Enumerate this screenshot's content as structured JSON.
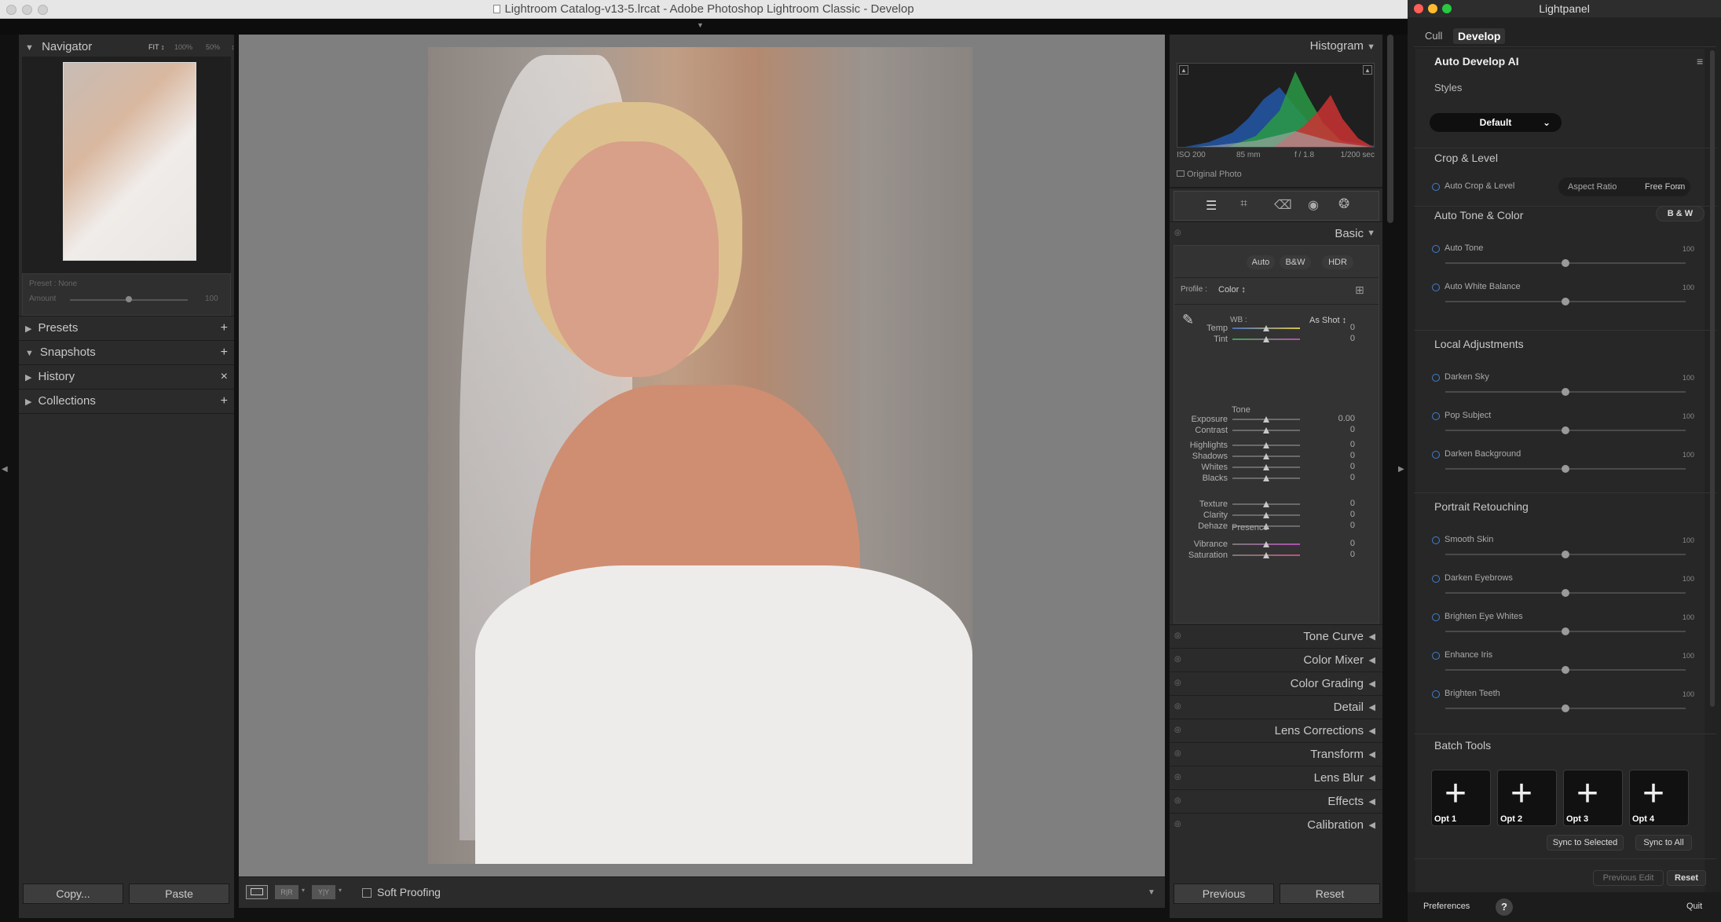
{
  "window": {
    "title": "Lightroom Catalog-v13-5.lrcat - Adobe Photoshop Lightroom Classic - Develop"
  },
  "navigator": {
    "title": "Navigator",
    "zoom_options": [
      "FIT",
      "100%",
      "50%"
    ],
    "fit_label": "FIT ↕"
  },
  "preset_box": {
    "preset_label": "Preset : None",
    "amount_label": "Amount",
    "amount_value": "100"
  },
  "left_panels": [
    {
      "label": "Presets",
      "action": "+"
    },
    {
      "label": "Snapshots",
      "action": "+"
    },
    {
      "label": "History",
      "action": "×"
    },
    {
      "label": "Collections",
      "action": "+"
    }
  ],
  "left_buttons": {
    "copy": "Copy...",
    "paste": "Paste"
  },
  "toolbar": {
    "soft_proofing": "Soft Proofing"
  },
  "histogram": {
    "title": "Histogram",
    "exif": {
      "iso": "ISO 200",
      "focal": "85 mm",
      "aperture": "f / 1.8",
      "shutter": "1/200 sec"
    },
    "original_photo": "Original Photo"
  },
  "basic": {
    "title": "Basic",
    "buttons": [
      "Auto",
      "B&W",
      "HDR"
    ],
    "profile_label": "Profile :",
    "profile_value": "Color",
    "wb_label": "WB :",
    "wb_value": "As Shot",
    "tone_label": "Tone",
    "presence_label": "Presence",
    "wb_sliders": [
      {
        "label": "Temp",
        "value": "0"
      },
      {
        "label": "Tint",
        "value": "0"
      }
    ],
    "tone_sliders": [
      {
        "label": "Exposure",
        "value": "0.00"
      },
      {
        "label": "Contrast",
        "value": "0"
      },
      {
        "label": "Highlights",
        "value": "0"
      },
      {
        "label": "Shadows",
        "value": "0"
      },
      {
        "label": "Whites",
        "value": "0"
      },
      {
        "label": "Blacks",
        "value": "0"
      }
    ],
    "presence_sliders": [
      {
        "label": "Texture",
        "value": "0"
      },
      {
        "label": "Clarity",
        "value": "0"
      },
      {
        "label": "Dehaze",
        "value": "0"
      },
      {
        "label": "Vibrance",
        "value": "0"
      },
      {
        "label": "Saturation",
        "value": "0"
      }
    ]
  },
  "right_panels": [
    "Tone Curve",
    "Color Mixer",
    "Color Grading",
    "Detail",
    "Lens Corrections",
    "Transform",
    "Lens Blur",
    "Effects",
    "Calibration"
  ],
  "right_buttons": {
    "previous": "Previous",
    "reset": "Reset"
  },
  "lightpanel": {
    "title": "Lightpanel",
    "tabs": [
      "Cull",
      "Develop"
    ],
    "heading": "Auto Develop AI",
    "styles_label": "Styles",
    "style_value": "Default",
    "crop_section": "Crop & Level",
    "auto_crop": "Auto Crop & Level",
    "aspect_label": "Aspect Ratio",
    "aspect_value": "Free Form",
    "tone_section": "Auto Tone & Color",
    "bw_button": "B & W",
    "tone_items": [
      {
        "label": "Auto Tone",
        "value": "100"
      },
      {
        "label": "Auto White Balance",
        "value": "100"
      }
    ],
    "local_section": "Local Adjustments",
    "local_items": [
      {
        "label": "Darken Sky",
        "value": "100"
      },
      {
        "label": "Pop Subject",
        "value": "100"
      },
      {
        "label": "Darken Background",
        "value": "100"
      }
    ],
    "portrait_section": "Portrait Retouching",
    "portrait_items": [
      {
        "label": "Smooth Skin",
        "value": "100"
      },
      {
        "label": "Darken Eyebrows",
        "value": "100"
      },
      {
        "label": "Brighten Eye Whites",
        "value": "100"
      },
      {
        "label": "Enhance Iris",
        "value": "100"
      },
      {
        "label": "Brighten Teeth",
        "value": "100"
      }
    ],
    "batch_section": "Batch Tools",
    "options": [
      "Opt 1",
      "Opt 2",
      "Opt 3",
      "Opt 4"
    ],
    "sync_selected": "Sync to Selected",
    "sync_all": "Sync to All",
    "previous_edit": "Previous Edit",
    "reset": "Reset",
    "preferences": "Preferences",
    "help": "?",
    "quit": "Quit"
  }
}
